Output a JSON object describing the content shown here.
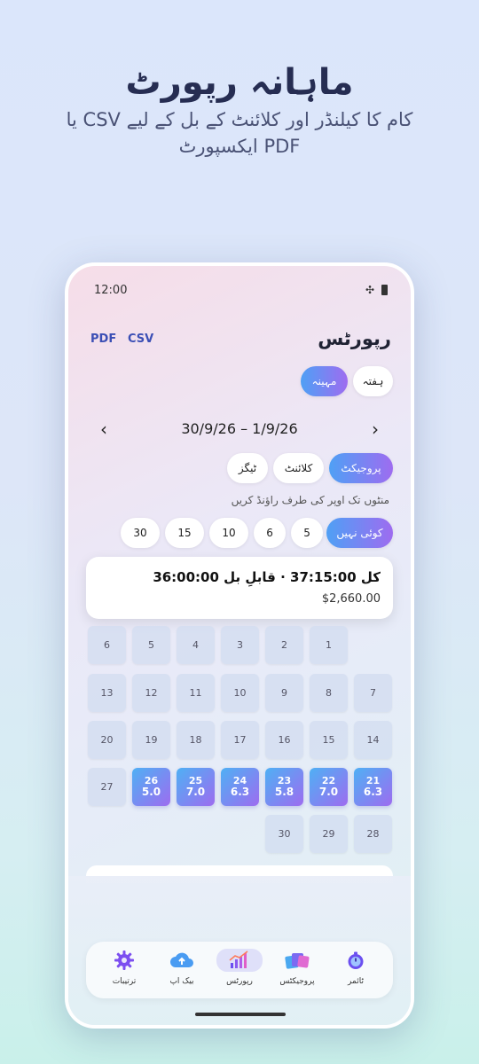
{
  "promo": {
    "title": "ماہانہ رپورٹ",
    "subtitle": "کام کا کیلنڈر اور کلائنٹ کے بل کے لیے CSV یا PDF ایکسپورٹ"
  },
  "status": {
    "time": "12:00"
  },
  "header": {
    "title": "رپورٹس",
    "export_pdf": "PDF",
    "export_csv": "CSV"
  },
  "period": {
    "week": "ہفتہ",
    "month": "مہینہ",
    "selected": "month"
  },
  "date_range": "30/9/26 – 1/9/26",
  "group_by": {
    "project": "پروجیکٹ",
    "client": "کلائنٹ",
    "tags": "ٹیگز",
    "selected": "project"
  },
  "rounding": {
    "hint": "منٹوں تک اوپر کی طرف راؤنڈ کریں",
    "options": [
      "کوئی نہیں",
      "5",
      "6",
      "10",
      "15",
      "30"
    ],
    "selected": "کوئی نہیں"
  },
  "totals": {
    "line": "کل 37:15:00 · قابلِ بل 36:00:00",
    "amount": "$2,660.00"
  },
  "calendar": {
    "days": [
      {
        "day": "1",
        "hours": ""
      },
      {
        "day": "2",
        "hours": ""
      },
      {
        "day": "3",
        "hours": ""
      },
      {
        "day": "4",
        "hours": ""
      },
      {
        "day": "5",
        "hours": ""
      },
      {
        "day": "6",
        "hours": ""
      },
      {
        "day": "7",
        "hours": ""
      },
      {
        "day": "8",
        "hours": ""
      },
      {
        "day": "9",
        "hours": ""
      },
      {
        "day": "10",
        "hours": ""
      },
      {
        "day": "11",
        "hours": ""
      },
      {
        "day": "12",
        "hours": ""
      },
      {
        "day": "13",
        "hours": ""
      },
      {
        "day": "14",
        "hours": ""
      },
      {
        "day": "15",
        "hours": ""
      },
      {
        "day": "16",
        "hours": ""
      },
      {
        "day": "17",
        "hours": ""
      },
      {
        "day": "18",
        "hours": ""
      },
      {
        "day": "19",
        "hours": ""
      },
      {
        "day": "20",
        "hours": ""
      },
      {
        "day": "21",
        "hours": "6.3"
      },
      {
        "day": "22",
        "hours": "7.0"
      },
      {
        "day": "23",
        "hours": "5.8"
      },
      {
        "day": "24",
        "hours": "6.3"
      },
      {
        "day": "25",
        "hours": "7.0"
      },
      {
        "day": "26",
        "hours": "5.0"
      },
      {
        "day": "27",
        "hours": ""
      },
      {
        "day": "28",
        "hours": ""
      },
      {
        "day": "29",
        "hours": ""
      },
      {
        "day": "30",
        "hours": ""
      }
    ]
  },
  "nav": [
    {
      "label": "ٹائمر",
      "icon": "stopwatch-icon"
    },
    {
      "label": "پروجیکٹس",
      "icon": "folders-icon"
    },
    {
      "label": "رپورٹس",
      "icon": "chart-icon"
    },
    {
      "label": "بیک اپ",
      "icon": "cloud-upload-icon"
    },
    {
      "label": "ترتیبات",
      "icon": "gear-icon"
    }
  ],
  "colors": {
    "accent_start": "#4fa0f5",
    "accent_end": "#9e6cf0"
  }
}
